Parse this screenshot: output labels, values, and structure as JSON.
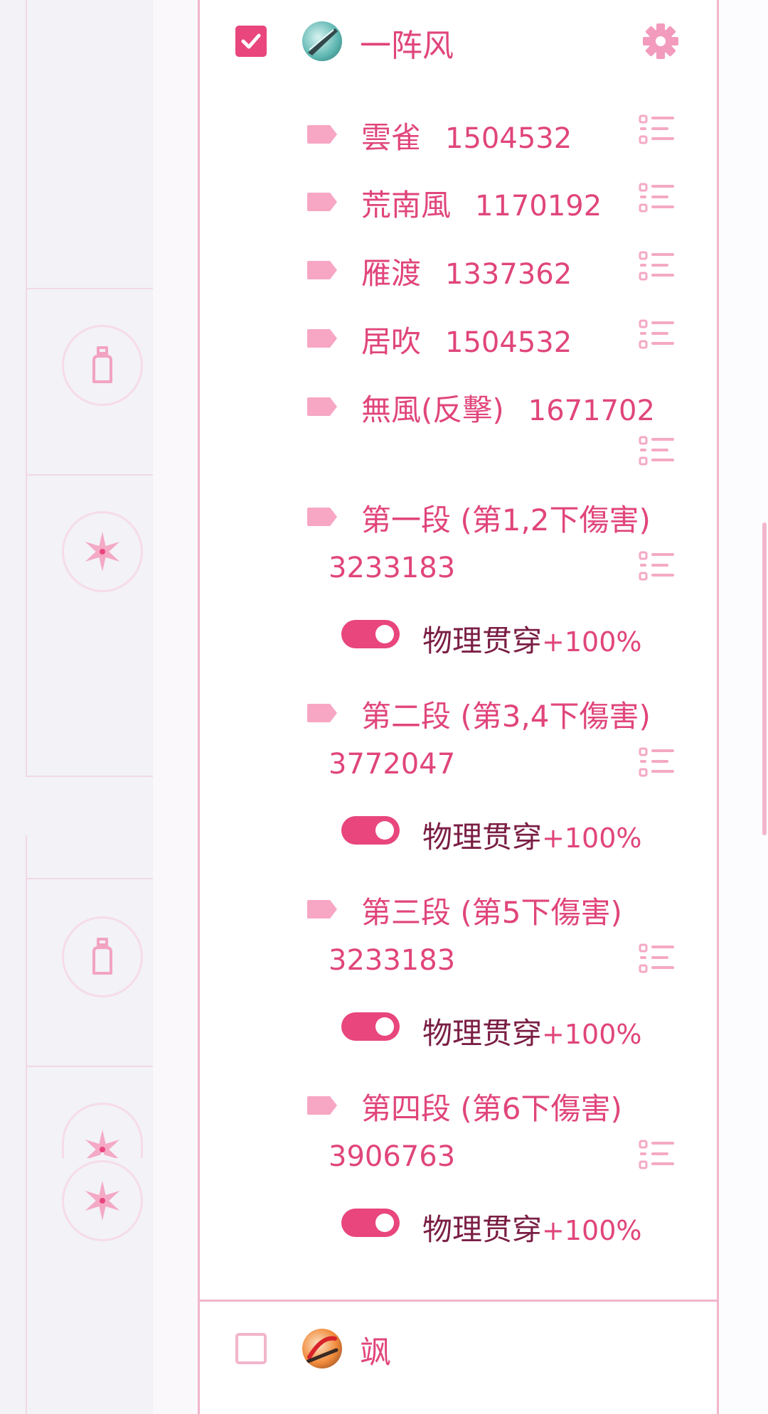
{
  "colors": {
    "accent": "#e8467c",
    "accent_text": "#e0457b",
    "dark_text": "#7a1e44",
    "border": "#f2b5cc"
  },
  "left_icons": [
    "bottle-icon",
    "star-flower-icon",
    "bottle-icon",
    "star-flower-icon",
    "star-flower-icon"
  ],
  "group_top": {
    "checked": true,
    "name": "一阵风",
    "avatar_icon": "blade-weapon-icon",
    "settings_icon": "gear-icon"
  },
  "skills": [
    {
      "label": "雲雀",
      "value": "1504532"
    },
    {
      "label": "荒南風",
      "value": "1170192"
    },
    {
      "label": "雁渡",
      "value": "1337362"
    },
    {
      "label": "居吹",
      "value": "1504532"
    },
    {
      "label": "無風(反擊)",
      "value": "1671702"
    }
  ],
  "segments": [
    {
      "label": "第一段 (第1,2下傷害)",
      "value": "3233183",
      "toggle_label": "物理贯穿",
      "toggle_pct": "+100%",
      "toggle_on": true
    },
    {
      "label": "第二段 (第3,4下傷害)",
      "value": "3772047",
      "toggle_label": "物理贯穿",
      "toggle_pct": "+100%",
      "toggle_on": true
    },
    {
      "label": "第三段 (第5下傷害)",
      "value": "3233183",
      "toggle_label": "物理贯穿",
      "toggle_pct": "+100%",
      "toggle_on": true
    },
    {
      "label": "第四段 (第6下傷害)",
      "value": "3906763",
      "toggle_label": "物理贯穿",
      "toggle_pct": "+100%",
      "toggle_on": true
    }
  ],
  "group_bottom": {
    "checked": false,
    "name": "飒",
    "avatar_icon": "fire-weapon-icon"
  }
}
